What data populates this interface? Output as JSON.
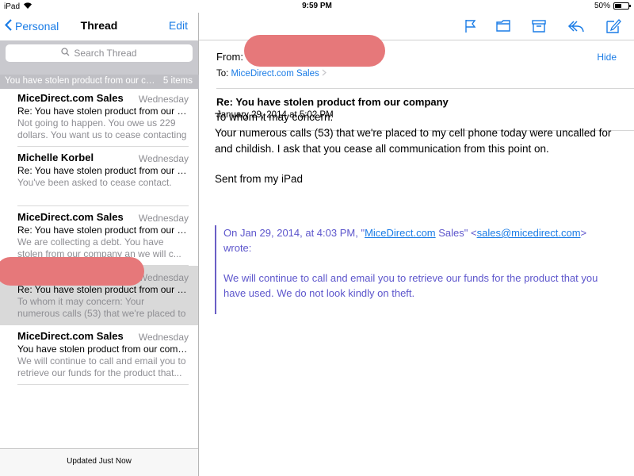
{
  "status_bar": {
    "device": "iPad",
    "time": "9:59 PM",
    "battery": "50%",
    "battery_level": 0.5
  },
  "left_nav": {
    "back_label": "Personal",
    "title": "Thread",
    "edit_label": "Edit"
  },
  "search": {
    "placeholder": "Search Thread"
  },
  "thread_summary": {
    "subject": "You have stolen product from our company",
    "count": "5 items"
  },
  "messages": [
    {
      "sender": "MiceDirect.com Sales",
      "date": "Wednesday",
      "subject": "Re: You have stolen product from our company",
      "preview": "Not going to happen. You owe us 229 dollars. You want us to cease contacting you..."
    },
    {
      "sender": "Michelle Korbel",
      "date": "Wednesday",
      "subject": "Re: You have stolen product from our company",
      "preview": "You've been asked to cease contact."
    },
    {
      "sender": "MiceDirect.com Sales",
      "date": "Wednesday",
      "subject": "Re: You have stolen product from our company",
      "preview": "We are collecting a debt. You have stolen from our company an we will c..."
    },
    {
      "sender": "",
      "date": "Wednesday",
      "subject": "Re: You have stolen product from our company",
      "preview": "To whom it may concern: Your numerous calls (53) that we're placed to my..."
    },
    {
      "sender": "MiceDirect.com Sales",
      "date": "Wednesday",
      "subject": "You have stolen product from our company",
      "preview": "We will continue to call and email you to retrieve our funds for the product that..."
    }
  ],
  "left_footer": {
    "status": "Updated Just Now"
  },
  "email": {
    "from_label": "From:",
    "hide_label": "Hide",
    "to_label": "To:",
    "to_address": "MiceDirect.com Sales",
    "subject": "Re: You have stolen product from our company",
    "date": "January 29, 2014 at 5:02 PM",
    "body": {
      "line1": "To whom it may concern:",
      "line2": "Your numerous calls (53) that we're placed to my cell phone today were uncalled for and childish. I ask that you cease all communication from this point on.",
      "signature": "Sent from my iPad"
    },
    "quote": {
      "prefix": "On Jan 29, 2014, at 4:03 PM, \"",
      "sender_link": "MiceDirect.com",
      "sender_rest": " Sales\" <",
      "email_link": "sales@micedirect.com",
      "suffix": ">",
      "wrote": "wrote:",
      "text": "We will continue to call and email you to retrieve our funds for the product that you have used.  We do not look kindly on theft."
    }
  },
  "colors": {
    "accent": "#1a7ce6",
    "quote": "#5d56cc",
    "redaction": "#e6787a",
    "selected_row": "#d9d9d9"
  }
}
